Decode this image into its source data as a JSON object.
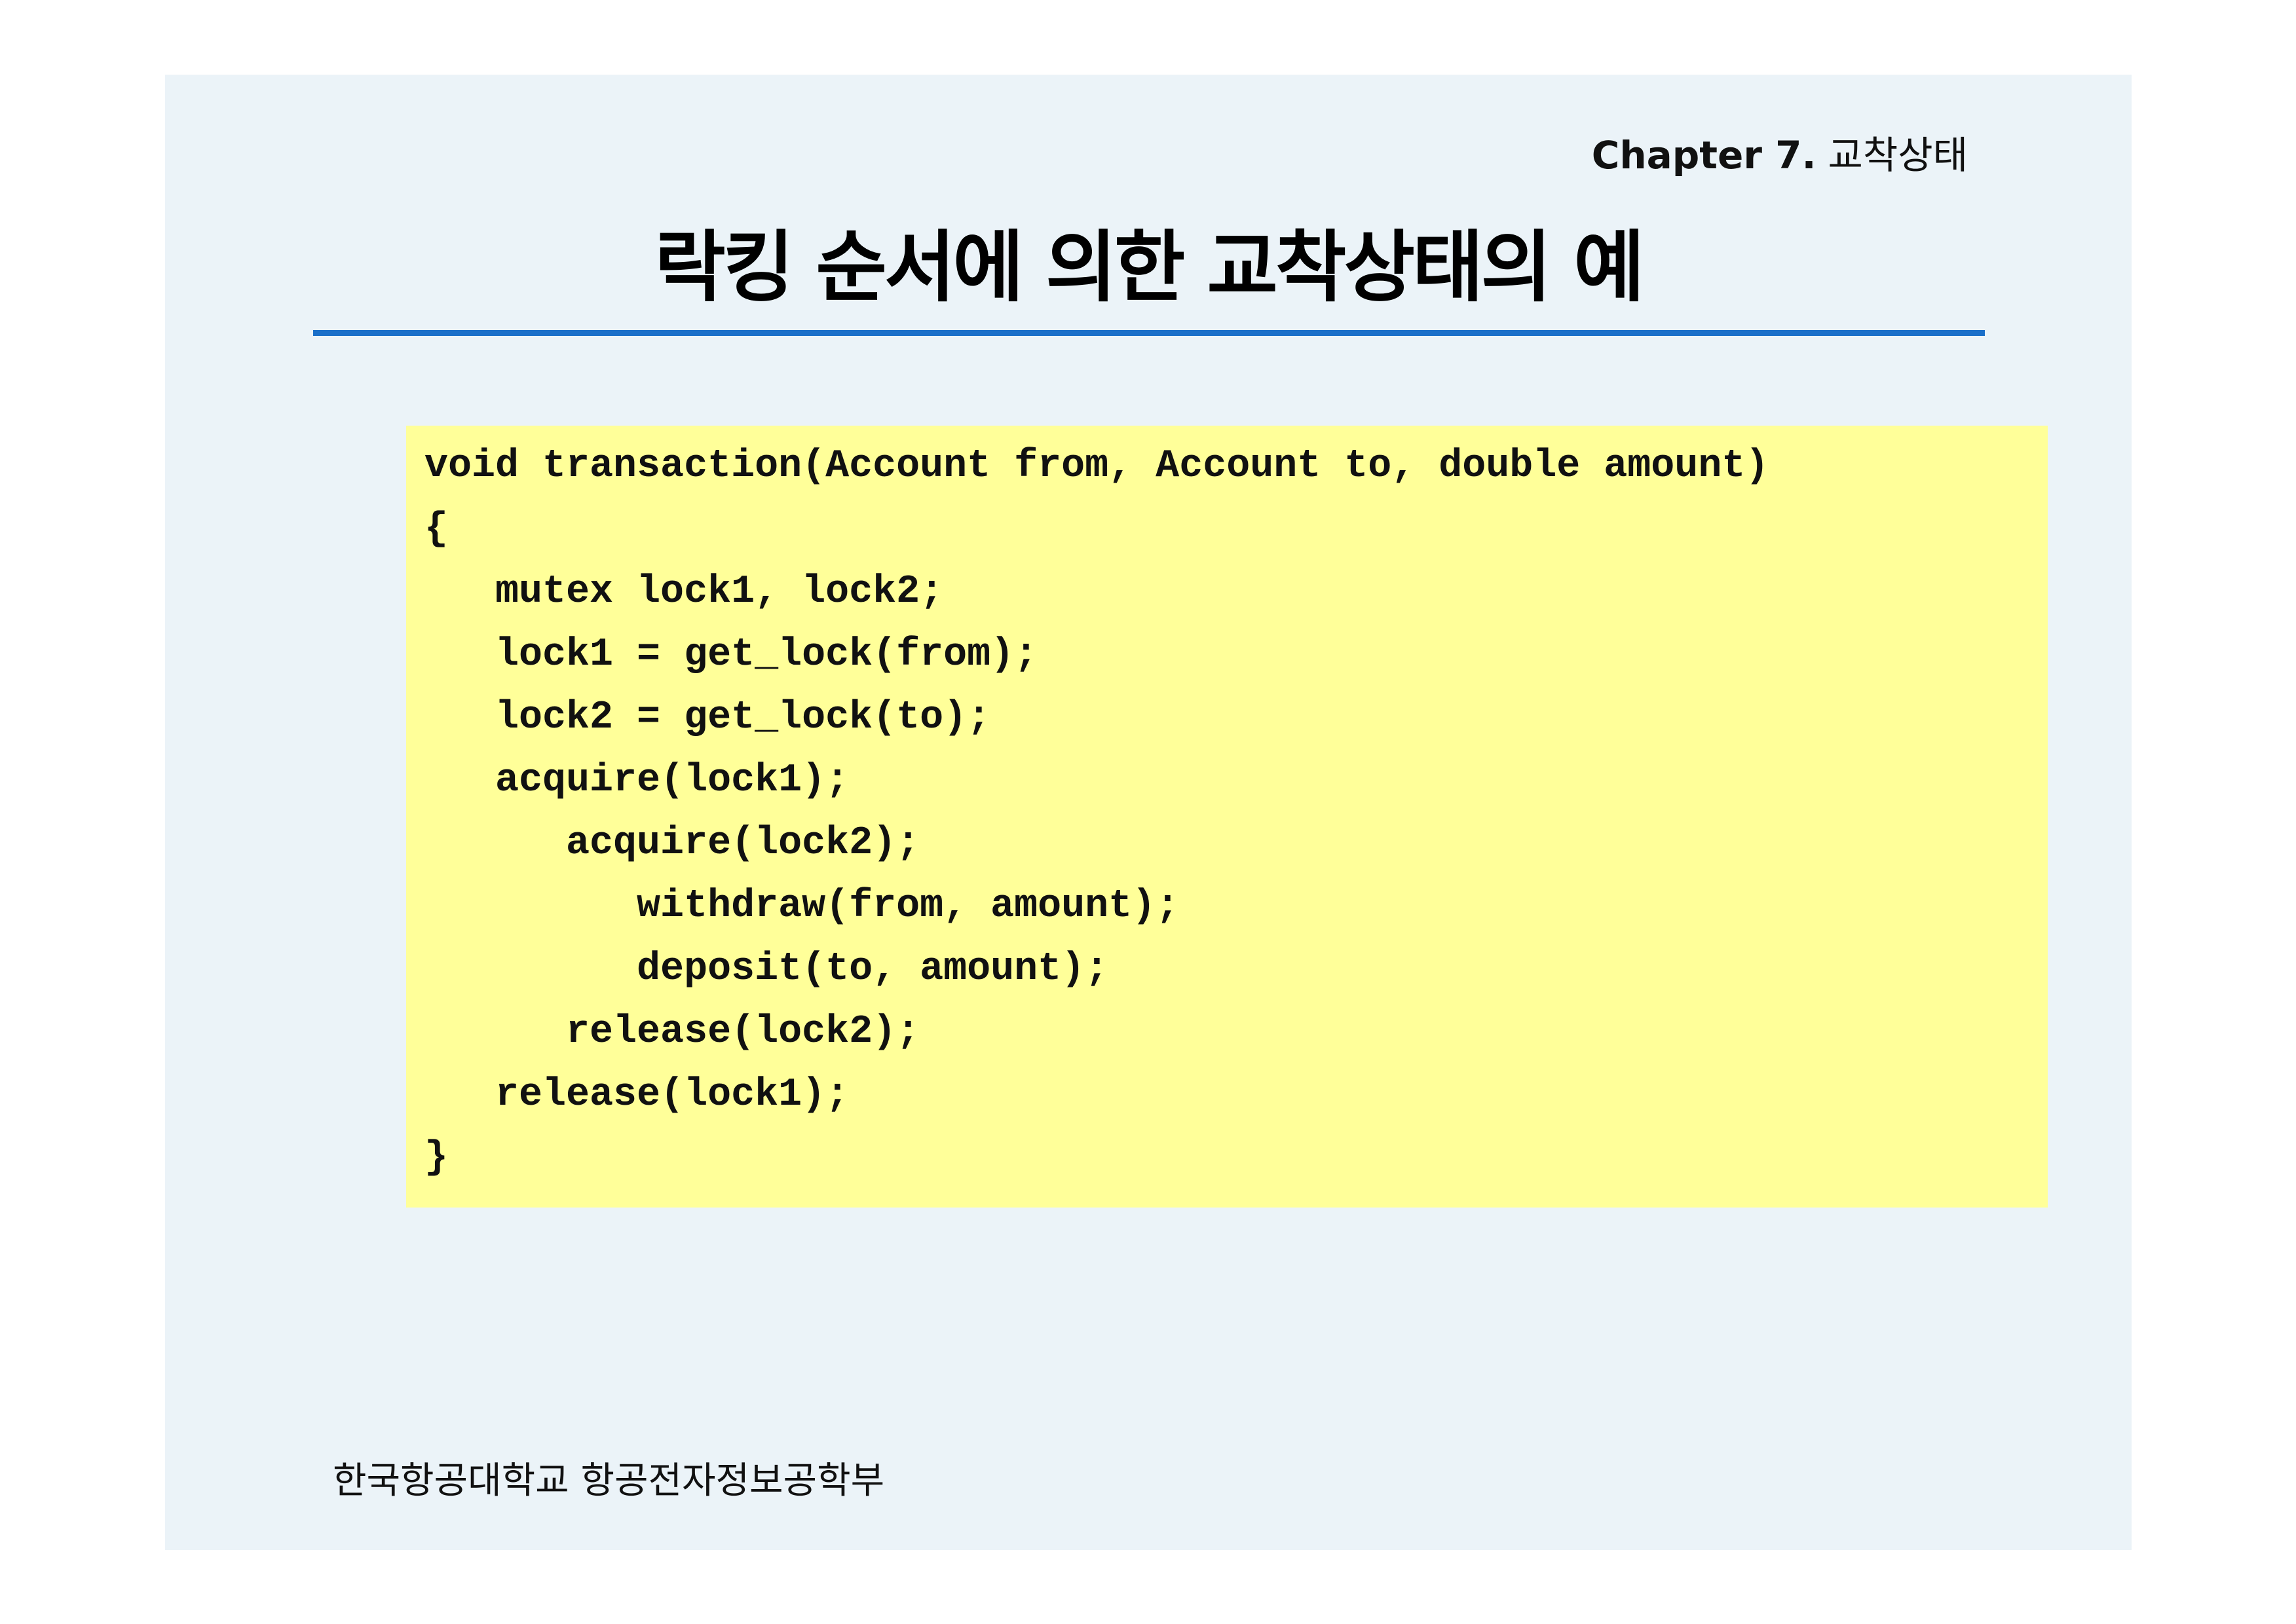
{
  "header": {
    "chapter_label": "Chapter 7.",
    "chapter_topic": "교착상태"
  },
  "title": "락킹 순서에 의한 교착상태의 예",
  "code_lines": [
    "void transaction(Account from, Account to, double amount)",
    "{",
    "   mutex lock1, lock2;",
    "   lock1 = get_lock(from);",
    "   lock2 = get_lock(to);",
    "   acquire(lock1);",
    "      acquire(lock2);",
    "         withdraw(from, amount);",
    "         deposit(to, amount);",
    "      release(lock2);",
    "   release(lock1);",
    "}"
  ],
  "footer": "한국항공대학교 항공전자정보공학부",
  "colors": {
    "slide_background": "#ebf3f8",
    "title_rule": "#1a6fc9",
    "code_background": "#ffff99"
  }
}
